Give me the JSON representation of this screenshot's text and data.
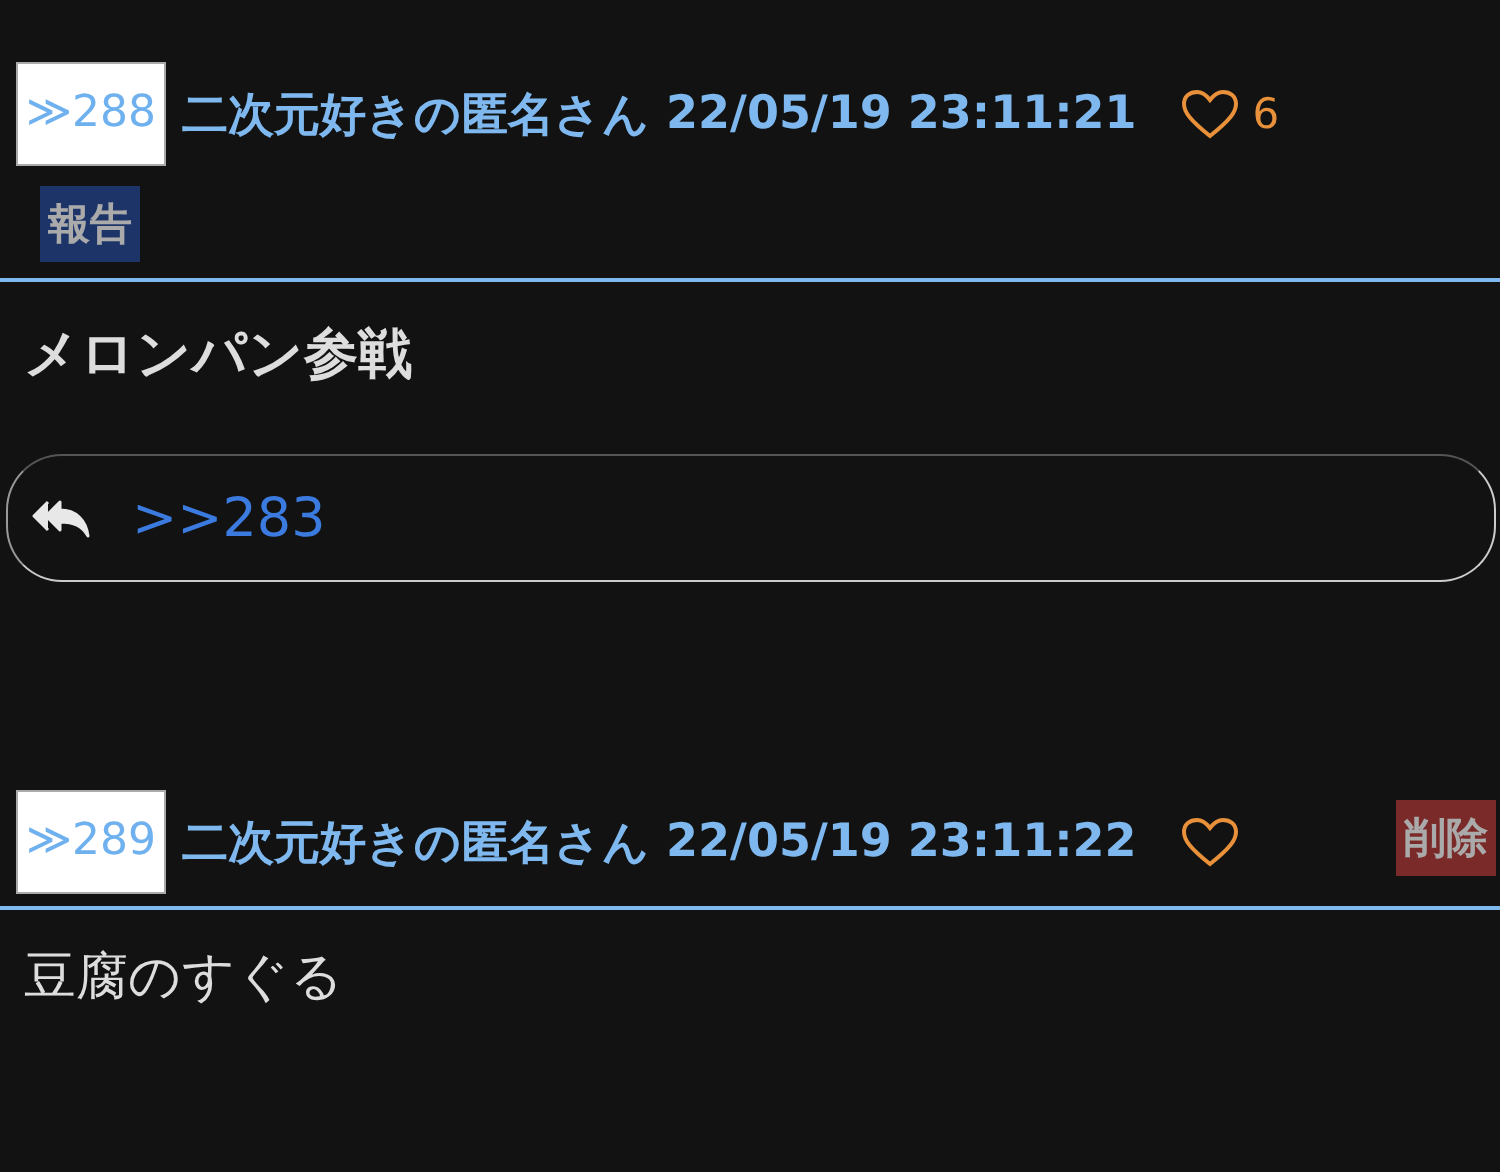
{
  "posts": [
    {
      "number": "≫288",
      "author": "二次元好きの匿名さん",
      "date": "22/05/19 23:11:21",
      "likes": "6",
      "action": {
        "kind": "report",
        "label": "報告"
      },
      "body": "メロンパン参戦",
      "bold": true,
      "reply": ">>283"
    },
    {
      "number": "≫289",
      "author": "二次元好きの匿名さん",
      "date": "22/05/19 23:11:22",
      "action": {
        "kind": "delete",
        "label": "削除"
      },
      "body": "豆腐のすぐる",
      "bold": false
    }
  ]
}
